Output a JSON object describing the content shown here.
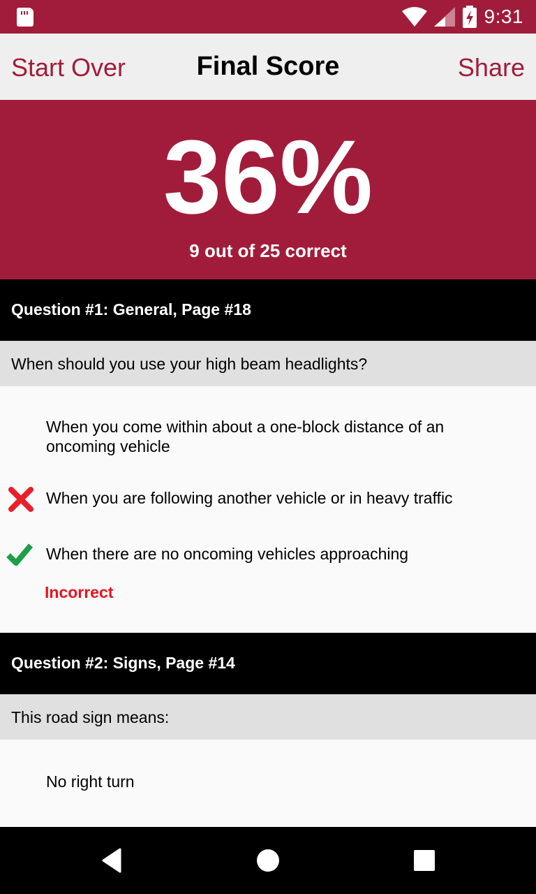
{
  "status_bar": {
    "time": "9:31",
    "icons": [
      "sd-card-icon",
      "wifi-icon",
      "cell-signal-icon",
      "battery-charging-icon"
    ]
  },
  "app_bar": {
    "left_button": "Start Over",
    "title": "Final Score",
    "right_button": "Share"
  },
  "score": {
    "percent": "36%",
    "summary": "9 out of 25 correct"
  },
  "questions": [
    {
      "header": "Question #1: General, Page #18",
      "prompt": "When should you use your high beam headlights?",
      "answers": [
        {
          "text": "When you come within about a one-block distance of an oncoming vehicle",
          "mark": "none"
        },
        {
          "text": "When you are following another vehicle or in heavy traffic",
          "mark": "wrong"
        },
        {
          "text": "When there are no oncoming vehicles approaching",
          "mark": "correct"
        }
      ],
      "result": "Incorrect"
    },
    {
      "header": "Question #2: Signs, Page #14",
      "prompt": "This road sign means:",
      "answers": [
        {
          "text": "No right turn",
          "mark": "none"
        }
      ]
    }
  ],
  "colors": {
    "brand": "#a11c3a",
    "correct": "#1e9e48",
    "wrong": "#e8202a",
    "incorrect_text": "#e8141e"
  },
  "nav_bar": {
    "icons": [
      "back-icon",
      "home-icon",
      "recents-icon"
    ]
  }
}
